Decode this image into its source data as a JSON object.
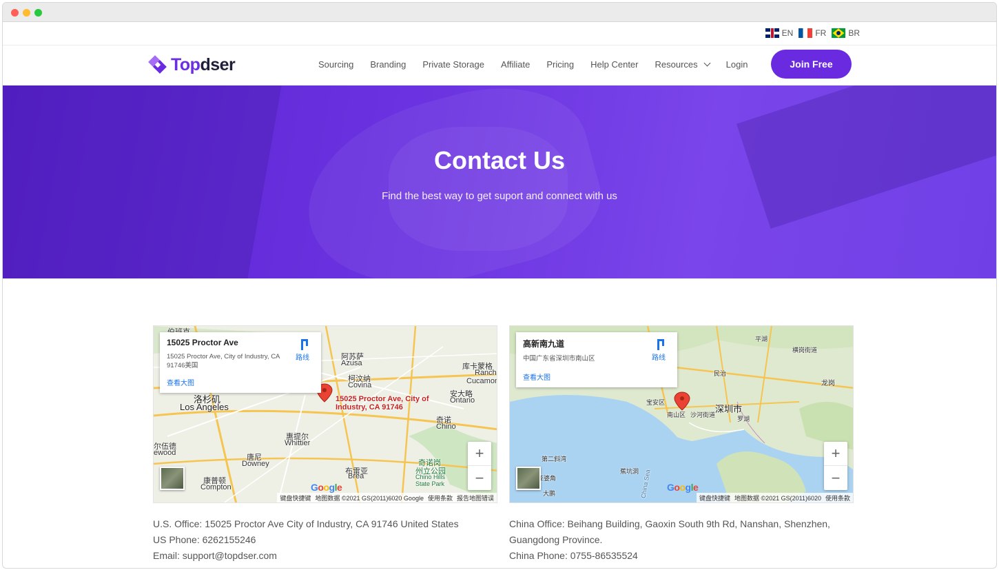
{
  "languages": [
    {
      "code": "EN"
    },
    {
      "code": "FR"
    },
    {
      "code": "BR"
    }
  ],
  "logo": {
    "part1": "Top",
    "part2": "dser"
  },
  "nav": {
    "items": [
      "Sourcing",
      "Branding",
      "Private Storage",
      "Affiliate",
      "Pricing",
      "Help Center",
      "Resources",
      "Login"
    ],
    "join_label": "Join Free"
  },
  "hero": {
    "title": "Contact Us",
    "subtitle": "Find the best way to get suport and connect with us"
  },
  "us_map": {
    "card_title": "15025 Proctor Ave",
    "card_address": "15025 Proctor Ave, City of Industry, CA 91746美国",
    "card_link": "查看大图",
    "directions": "路线",
    "pin_label": "15025 Proctor Ave, City of Industry, CA 91746",
    "labels": [
      "阿苏萨",
      "Azusa",
      "柯汶纳",
      "Covina",
      "库卡蒙格",
      "Rancho",
      "Cucamon",
      "安大略",
      "Ontario",
      "奇诺",
      "Chino",
      "洛杉矶",
      "Los Angeles",
      "惠提尔",
      "Whittier",
      "唐尼",
      "Downey",
      "康普顿",
      "Compton",
      "布雷亚",
      "Brea",
      "奇诺岗",
      "州立公园",
      "Chino Hills",
      "State Park",
      "尔伍德",
      "ewood",
      "伯班克"
    ],
    "attribution": [
      "键盘快捷键",
      "地图数据 ©2021 GS(2011)6020 Google",
      "使用条款",
      "报告地图错误"
    ]
  },
  "cn_map": {
    "card_title": "高新南九道",
    "card_address": "中国广东省深圳市南山区",
    "card_link": "查看大图",
    "directions": "路线",
    "labels": [
      "深圳市",
      "宝安区",
      "南山区",
      "平湖",
      "横岗街道",
      "民治",
      "龙岗",
      "沙河街道",
      "罗湖",
      "第二斜湾",
      "亚婆角",
      "大鹏",
      "蕉坑洞",
      "China Sea"
    ],
    "attribution": [
      "键盘快捷键",
      "地图数据 ©2021 GS(2011)6020",
      "使用条款"
    ]
  },
  "us_office": {
    "address": "U.S. Office: 15025 Proctor Ave City of Industry, CA 91746 United States",
    "phone": "US Phone: 6262155246",
    "email": "Email: support@topdser.com"
  },
  "cn_office": {
    "address": "China Office: Beihang Building, Gaoxin South 9th Rd, Nanshan, Shenzhen, Guangdong Province.",
    "phone": "China Phone: 0755-86535524"
  },
  "colors": {
    "brand": "#6a2be0",
    "hero": "#6a32e0"
  }
}
